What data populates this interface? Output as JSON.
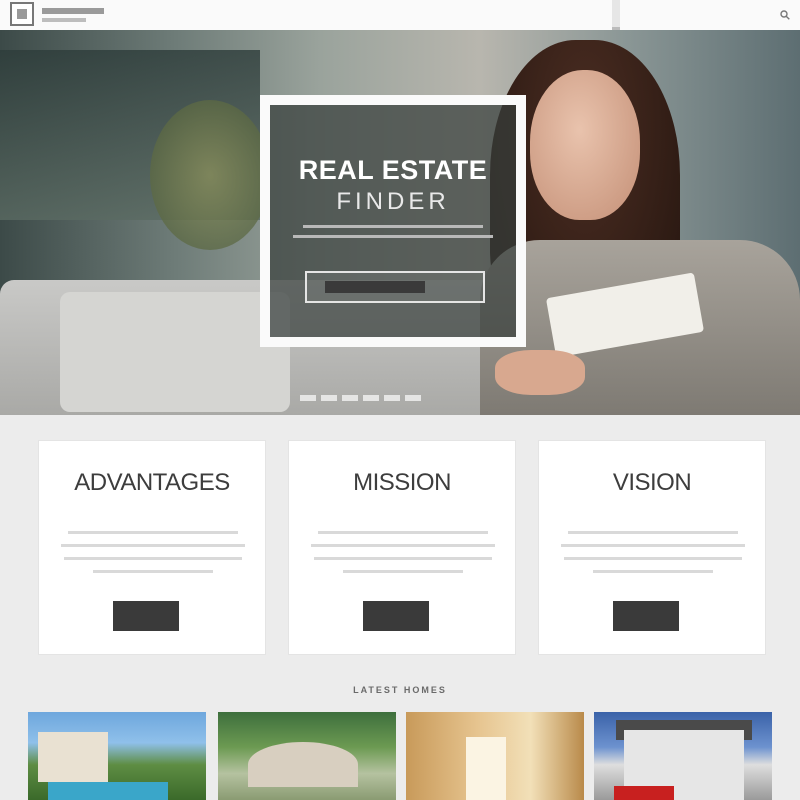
{
  "hero": {
    "title_line1": "REAL ESTATE",
    "title_line2": "FINDER"
  },
  "cards": [
    {
      "title": "ADVANTAGES"
    },
    {
      "title": "MISSION"
    },
    {
      "title": "VISION"
    }
  ],
  "listings": {
    "heading": "LATEST HOMES",
    "photos": [
      {
        "subject": "house-with-pool"
      },
      {
        "subject": "house-in-trees"
      },
      {
        "subject": "interior-room"
      },
      {
        "subject": "house-for-sale"
      }
    ]
  },
  "icons": {
    "search": "search-icon",
    "logo": "house-logo-icon"
  },
  "colors": {
    "dark_button": "#3a3a3a",
    "page_background": "#ececec",
    "frame": "#fafafa"
  }
}
